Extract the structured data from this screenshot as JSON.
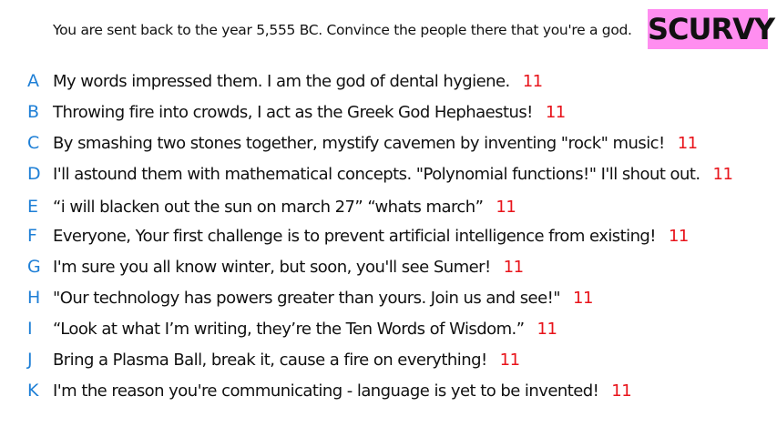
{
  "prompt": "You are sent back to the year 5,555 BC. Convince the people there that you're a god.",
  "player_badge": {
    "name": "SCURVY",
    "color": "#ff8ef0"
  },
  "colors": {
    "letter": "#1e7fd6",
    "score": "#e8141b",
    "text": "#111111",
    "background": "#ffffff"
  },
  "answers": [
    {
      "letter": "A",
      "text": "My words impressed them. I am the god of dental hygiene.",
      "score": "11"
    },
    {
      "letter": "B",
      "text": "Throwing fire into crowds, I act as the Greek God Hephaestus!",
      "score": "11"
    },
    {
      "letter": "C",
      "text": "By smashing two stones together, mystify cavemen by inventing \"rock\" music!",
      "score": "11"
    },
    {
      "letter": "D",
      "text": "I'll astound them with mathematical concepts. \"Polynomial functions!\" I'll shout out.",
      "score": "11"
    },
    {
      "letter": "E",
      "text": "“i will blacken out the sun on march 27” “whats march”",
      "score": "11"
    },
    {
      "letter": "F",
      "text": "Everyone, Your first challenge is to prevent artificial intelligence from existing!",
      "score": "11"
    },
    {
      "letter": "G",
      "text": "I'm sure you all know winter, but soon, you'll see Sumer!",
      "score": "11"
    },
    {
      "letter": "H",
      "text": "\"Our technology has powers greater than yours. Join us and see!\"",
      "score": "11"
    },
    {
      "letter": "I",
      "text": "“Look at what I’m writing, they’re the Ten Words of Wisdom.”",
      "score": "11"
    },
    {
      "letter": "J",
      "text": "Bring a Plasma Ball, break it, cause a fire on everything!",
      "score": "11"
    },
    {
      "letter": "K",
      "text": "I'm the reason you're communicating - language is yet to be invented!",
      "score": "11"
    }
  ]
}
